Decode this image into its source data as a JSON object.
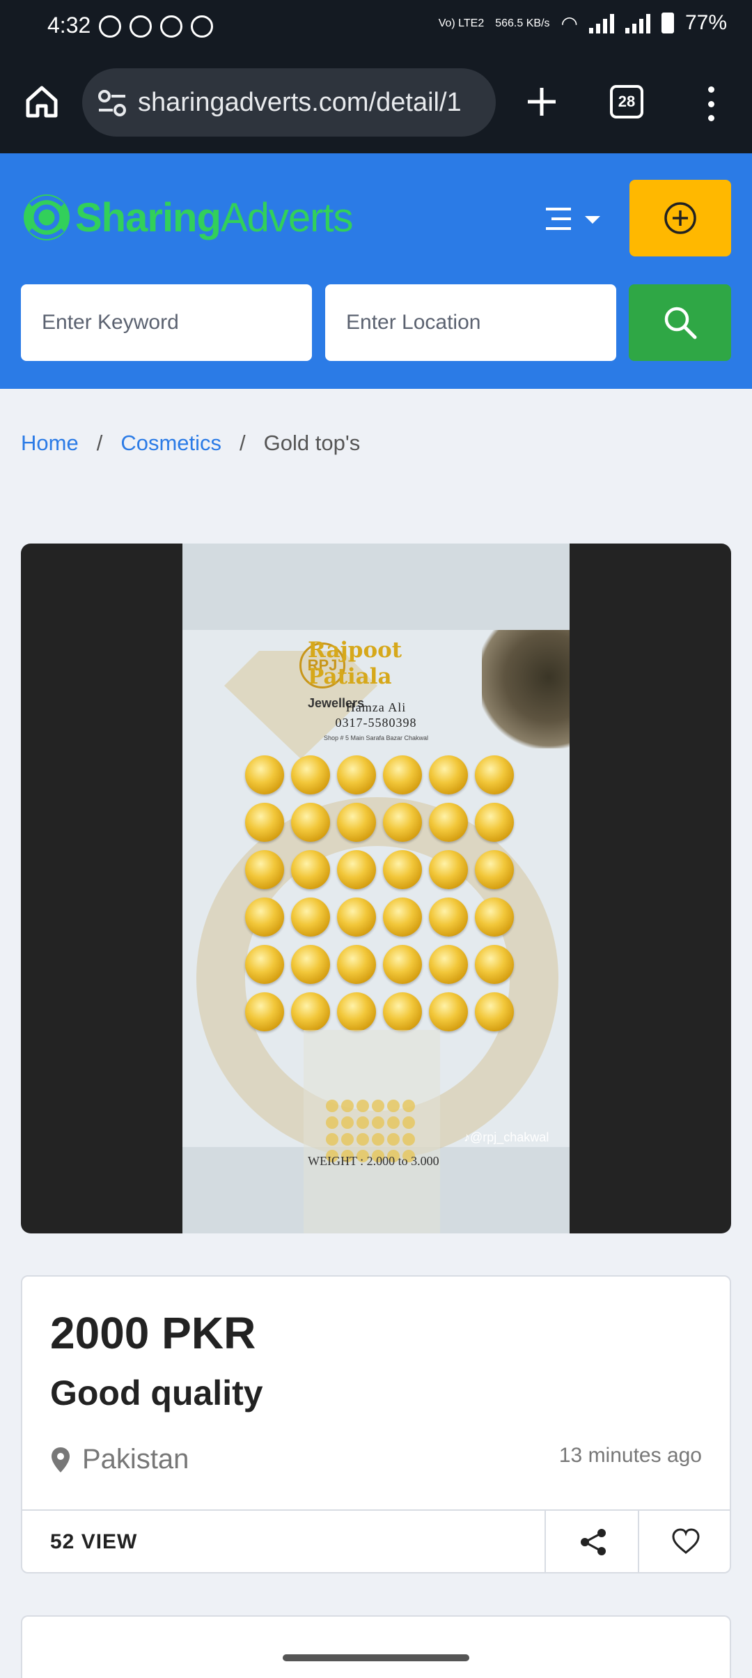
{
  "status_bar": {
    "time": "4:32",
    "network_type": "Vo) LTE2",
    "speed": "566.5 KB/s",
    "battery": "77%"
  },
  "browser": {
    "url": "sharingadverts.com/detail/1",
    "tab_count": "28"
  },
  "site": {
    "logo_bold": "Sharing",
    "logo_light": "Adverts",
    "brand_color": "#2b7be6",
    "search": {
      "keyword_placeholder": "Enter Keyword",
      "location_placeholder": "Enter Location"
    }
  },
  "breadcrumb": {
    "home": "Home",
    "sep": "/",
    "category": "Cosmetics",
    "current": "Gold top's"
  },
  "photo": {
    "brand_line1": "Rajpoot",
    "brand_line2": "Patiala",
    "brand_line3": "Jewellers",
    "logo_letters": "RPJ",
    "contact_name": "Hamza Ali",
    "contact_phone": "0317-5580398",
    "shop_address": "Shop # 5 Main Sarafa Bazar Chakwal",
    "weight": "WEIGHT : 2.000 to 3.000",
    "handle": "♪@rpj_chakwal"
  },
  "listing": {
    "price": "2000 PKR",
    "title": "Good quality",
    "location": "Pakistan",
    "posted": "13 minutes ago",
    "views": "52 VIEW"
  }
}
